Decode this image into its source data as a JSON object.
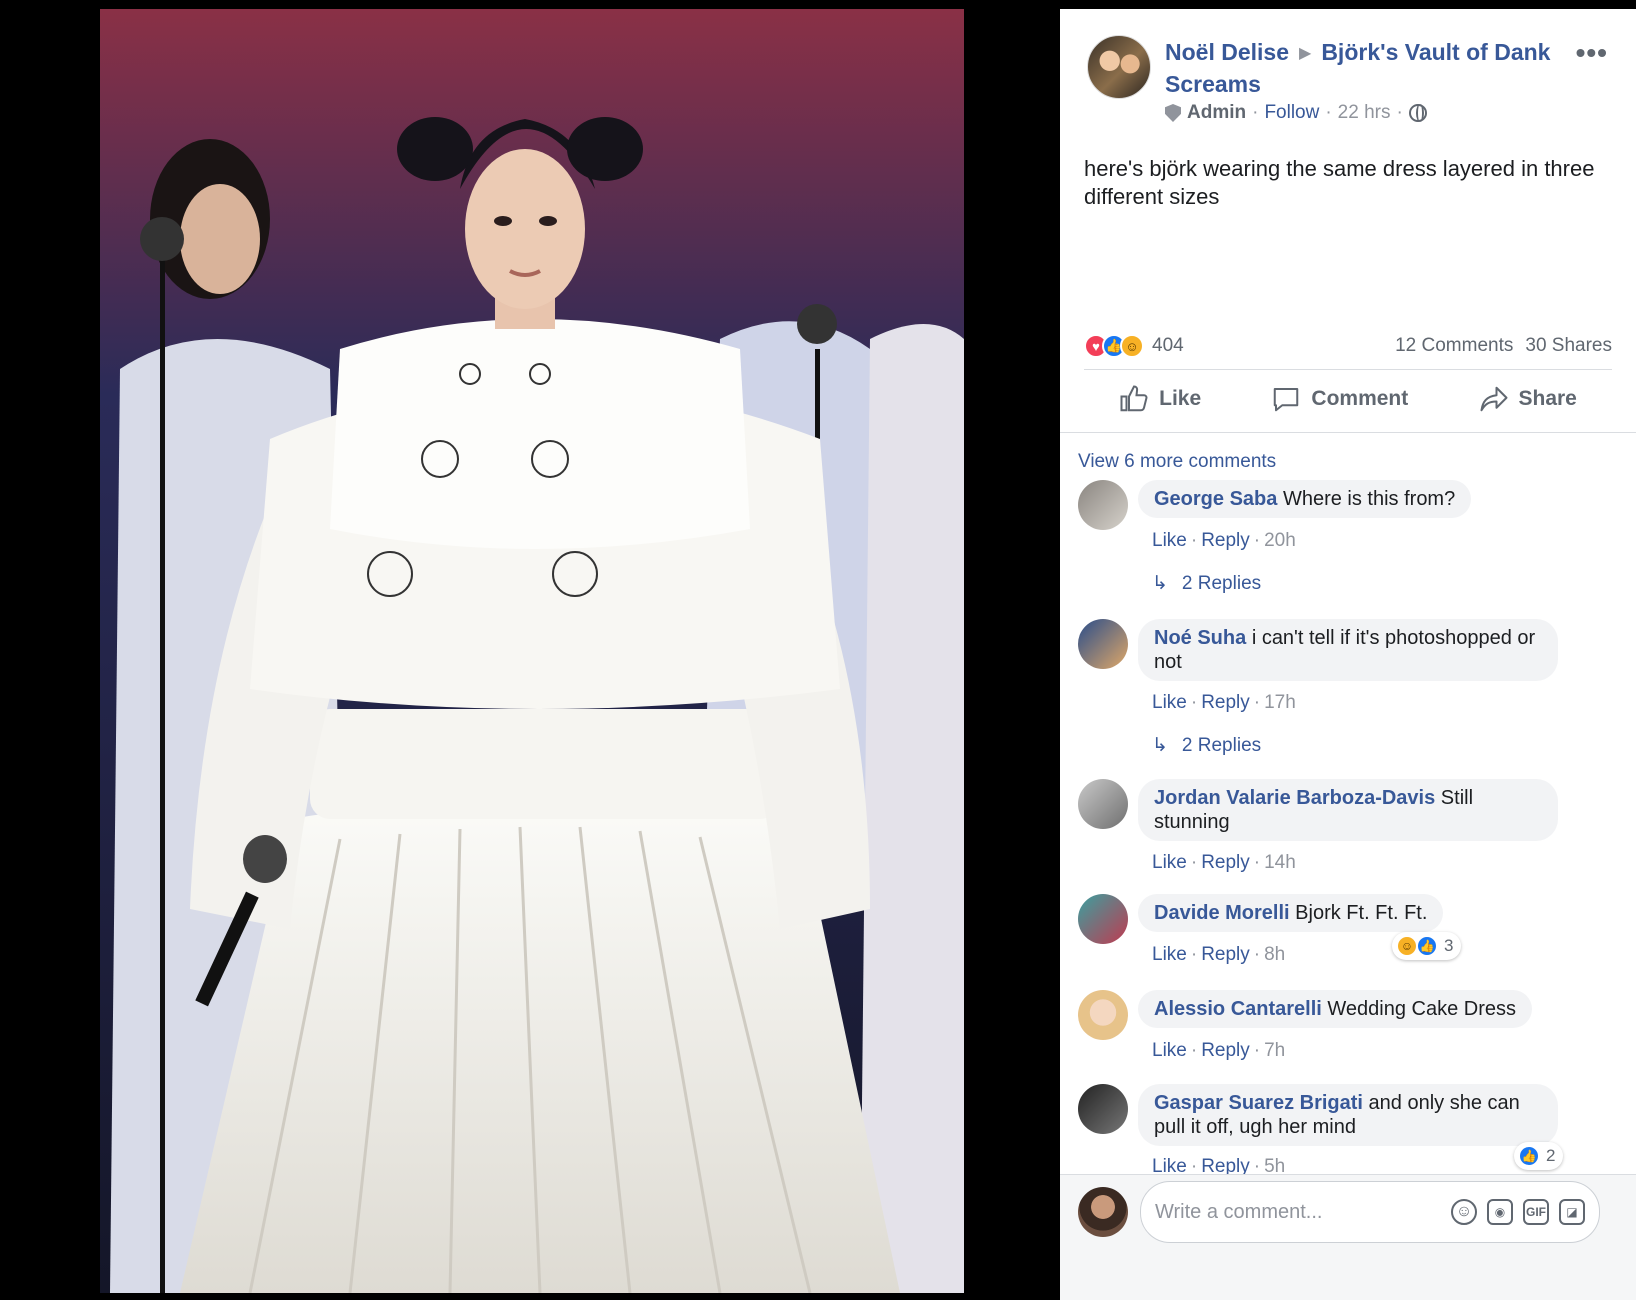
{
  "post": {
    "author": "Noël Delise",
    "group": "Björk's Vault of Dank Screams",
    "role": "Admin",
    "follow": "Follow",
    "time": "22 hrs",
    "text": "here's björk wearing the same dress layered in three different sizes",
    "reaction_count": "404",
    "comments_count": "12 Comments",
    "shares_count": "30 Shares",
    "more_menu": "•••"
  },
  "actions": {
    "like": "Like",
    "comment": "Comment",
    "share": "Share"
  },
  "comments": {
    "view_more": "View 6 more comments",
    "like_label": "Like",
    "reply_label": "Reply",
    "items": [
      {
        "name": "George Saba",
        "text": "Where is this from?",
        "time": "20h",
        "replies": "2 Replies"
      },
      {
        "name": "Noé Suha",
        "text": "i can't tell if it's photoshopped or not",
        "time": "17h",
        "replies": "2 Replies"
      },
      {
        "name": "Jordan Valarie Barboza-Davis",
        "text": "Still stunning",
        "time": "14h"
      },
      {
        "name": "Davide Morelli",
        "text": "Bjork Ft. Ft. Ft.",
        "time": "8h",
        "reactions": "3"
      },
      {
        "name": "Alessio Cantarelli",
        "text": "Wedding Cake Dress",
        "time": "7h"
      },
      {
        "name": "Gaspar Suarez Brigati",
        "text": "and only she can pull it off, ugh her mind",
        "time": "5h",
        "reactions": "2"
      }
    ]
  },
  "composer": {
    "placeholder": "Write a comment..."
  },
  "icons": {
    "reactions": [
      "love-icon",
      "like-icon",
      "haha-icon"
    ],
    "composer_tools": [
      "emoji-icon",
      "camera-icon",
      "gif-icon",
      "sticker-icon"
    ]
  },
  "colors": {
    "link": "#385898",
    "muted": "#90949c",
    "bubble": "#f2f3f5",
    "like_blue": "#1877f2",
    "love_red": "#f33e58"
  }
}
